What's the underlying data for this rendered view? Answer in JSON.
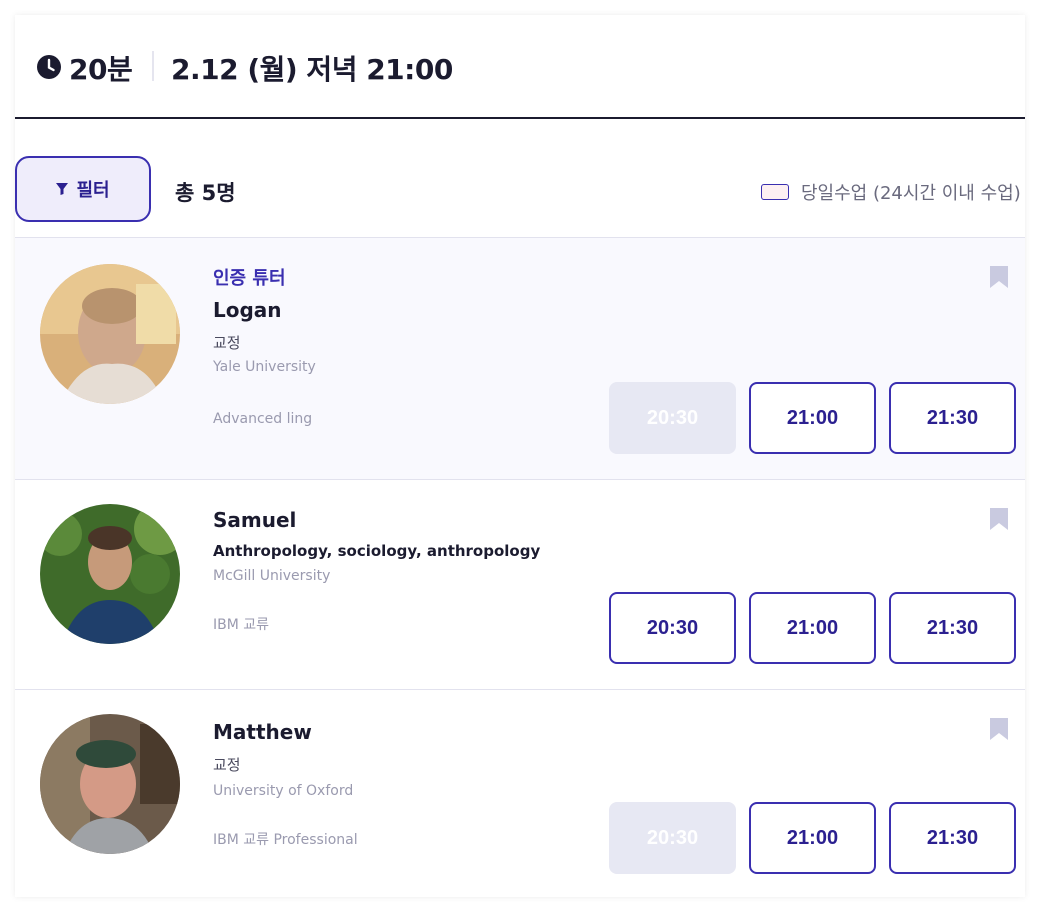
{
  "header": {
    "duration": "20분",
    "datetime": "2.12 (월) 저녁 21:00",
    "icon": "clock-icon"
  },
  "toolbar": {
    "filter_label": "필터",
    "filter_icon": "filter-icon",
    "total": "총 5명",
    "sameday_label": "당일수업 (24시간 이내 수업)",
    "sameday_checked": false
  },
  "tutors": [
    {
      "tag": "인증 튜터",
      "name": "Logan",
      "line1": "교정",
      "line2": "Yale University",
      "line3": "Advanced ling",
      "slots": [
        {
          "time": "20:30",
          "available": false
        },
        {
          "time": "21:00",
          "available": true
        },
        {
          "time": "21:30",
          "available": true
        }
      ]
    },
    {
      "name": "Samuel",
      "line1": "Anthropology, sociology, anthropology",
      "line2": "McGill University",
      "line3": "IBM 교류",
      "slots": [
        {
          "time": "20:30",
          "available": true
        },
        {
          "time": "21:00",
          "available": true
        },
        {
          "time": "21:30",
          "available": true
        }
      ]
    },
    {
      "name": "Matthew",
      "line1": "교정",
      "line2": "University of Oxford",
      "line3": "IBM 교류 Professional",
      "slots": [
        {
          "time": "20:30",
          "available": false
        },
        {
          "time": "21:00",
          "available": true
        },
        {
          "time": "21:30",
          "available": true
        }
      ]
    }
  ],
  "colors": {
    "accent": "#3a2fb0",
    "text": "#1b1b2f",
    "disabled_slot": "#e7e8f3",
    "highlight_card": "#f9f9fe"
  }
}
